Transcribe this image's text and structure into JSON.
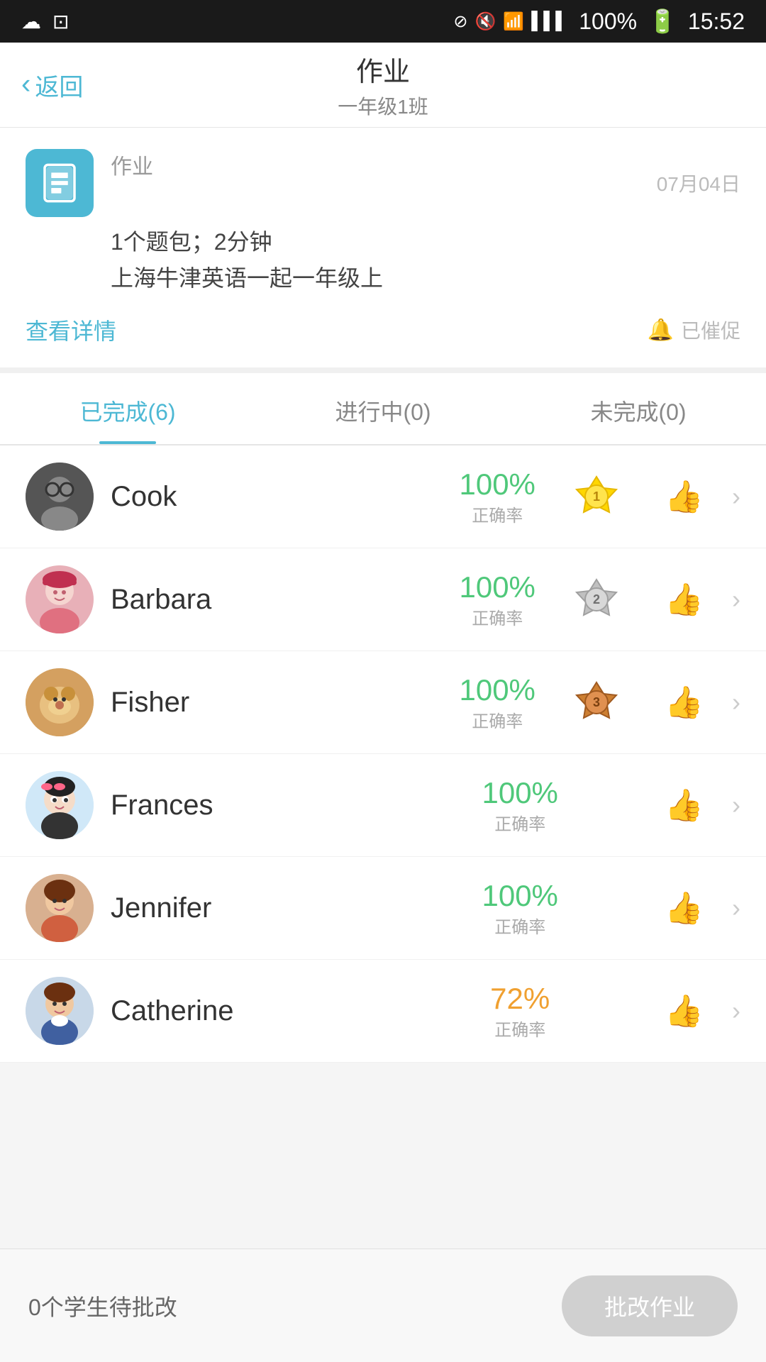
{
  "statusBar": {
    "time": "15:52",
    "battery": "100%",
    "icons": [
      "cloud",
      "image",
      "bluetooth",
      "mute",
      "wifi",
      "signal"
    ]
  },
  "header": {
    "backLabel": "返回",
    "title": "作业",
    "subtitle": "一年级1班"
  },
  "assignment": {
    "iconAlt": "document-icon",
    "label": "作业",
    "date": "07月04日",
    "detail1": "1个题包；2分钟",
    "detail2": "上海牛津英语一起一年级上",
    "viewDetail": "查看详情",
    "reminder": "已催促"
  },
  "tabs": [
    {
      "id": "completed",
      "label": "已完成(6)",
      "active": true
    },
    {
      "id": "inprogress",
      "label": "进行中(0)",
      "active": false
    },
    {
      "id": "incomplete",
      "label": "未完成(0)",
      "active": false
    }
  ],
  "students": [
    {
      "id": "cook",
      "name": "Cook",
      "score": "100%",
      "scoreLabel": "正确率",
      "rank": 1,
      "rankColor": "gold"
    },
    {
      "id": "barbara",
      "name": "Barbara",
      "score": "100%",
      "scoreLabel": "正确率",
      "rank": 2,
      "rankColor": "silver"
    },
    {
      "id": "fisher",
      "name": "Fisher",
      "score": "100%",
      "scoreLabel": "正确率",
      "rank": 3,
      "rankColor": "bronze"
    },
    {
      "id": "frances",
      "name": "Frances",
      "score": "100%",
      "scoreLabel": "正确率",
      "rank": 0,
      "rankColor": ""
    },
    {
      "id": "jennifer",
      "name": "Jennifer",
      "score": "100%",
      "scoreLabel": "正确率",
      "rank": 0,
      "rankColor": ""
    },
    {
      "id": "catherine",
      "name": "Catherine",
      "score": "72%",
      "scoreLabel": "正确率",
      "rank": 0,
      "rankColor": ""
    }
  ],
  "bottomBar": {
    "pendingText": "0个学生待批改",
    "gradeBtn": "批改作业"
  }
}
